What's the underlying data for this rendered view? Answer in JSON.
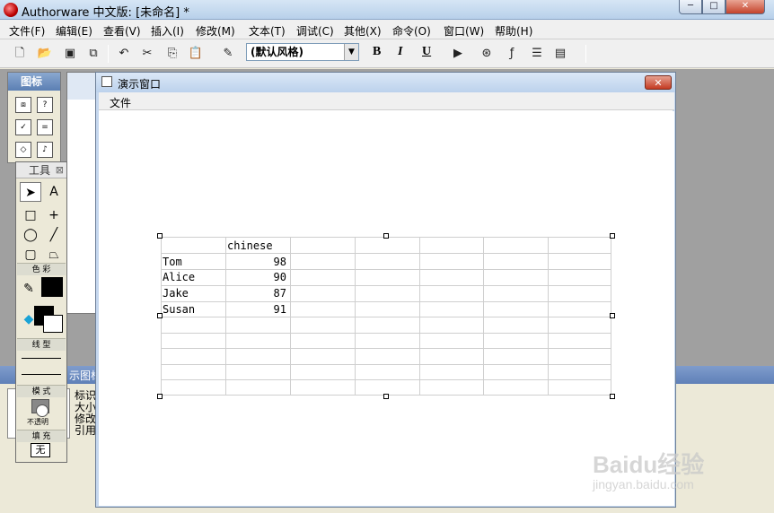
{
  "app": {
    "title": "Authorware 中文版: [未命名] *",
    "window_buttons": {
      "minimize": "─",
      "maximize": "□",
      "close": "✕"
    }
  },
  "menubar": [
    "文件(F)",
    "编辑(E)",
    "查看(V)",
    "插入(I)",
    "修改(M)",
    "文本(T)",
    "调试(C)",
    "其他(X)",
    "命令(O)",
    "窗口(W)",
    "帮助(H)"
  ],
  "toolbar": {
    "style_select": "(默认风格)",
    "bold": "B",
    "italic": "I",
    "underline": "U"
  },
  "icon_palette": {
    "title": "图标"
  },
  "tools": {
    "title": "工具",
    "sections": {
      "color": "色 彩",
      "line": "线 型",
      "mode": "模 式",
      "fill": "填 充"
    },
    "mode_label": "不透明",
    "fill_value": "无"
  },
  "properties": {
    "strip_title": "示图标",
    "labels": [
      "标识",
      "大小",
      "修改",
      "引用"
    ]
  },
  "presentation": {
    "title": "演示窗口",
    "close": "✕",
    "menu": "文件",
    "table": {
      "header": [
        "",
        "chinese"
      ],
      "rows": [
        {
          "name": "Tom",
          "score": "98"
        },
        {
          "name": "Alice",
          "score": "90"
        },
        {
          "name": "Jake",
          "score": "87"
        },
        {
          "name": "Susan",
          "score": "91"
        }
      ]
    }
  },
  "watermark": {
    "brand": "Baidu经验",
    "url": "jingyan.baidu.com"
  }
}
